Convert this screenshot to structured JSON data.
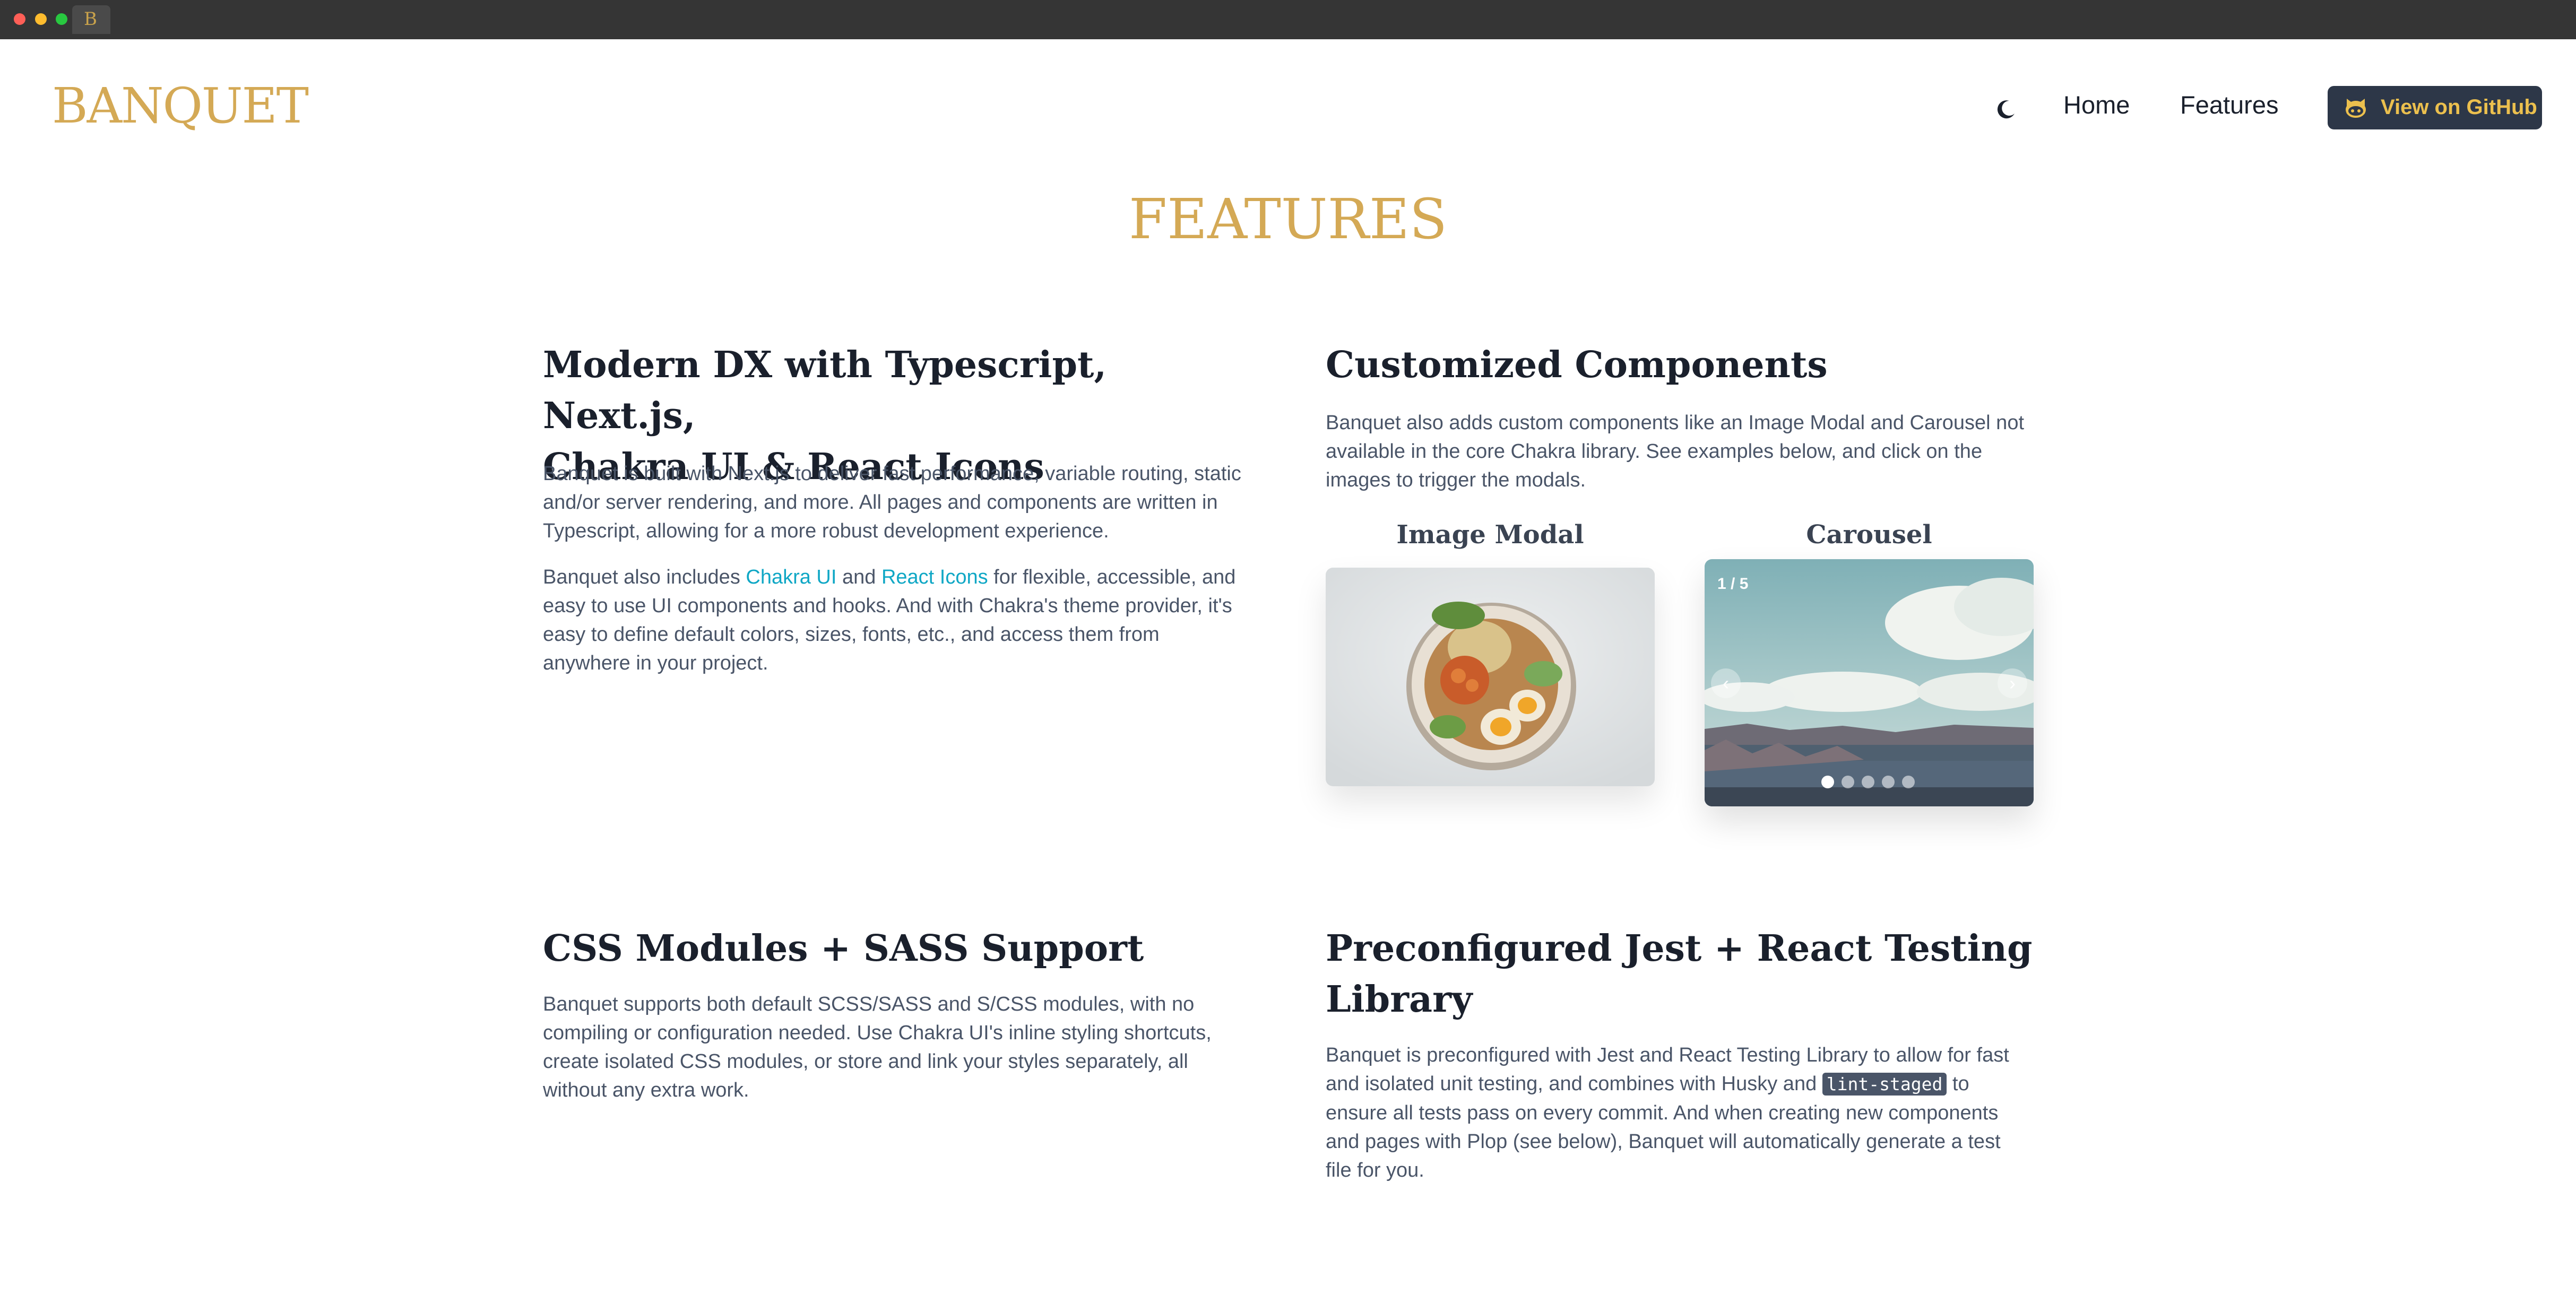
{
  "window": {
    "tab_icon_letter": "B"
  },
  "header": {
    "logo": "BANQUET",
    "theme_toggle_icon": "moon-icon",
    "nav": {
      "home": "Home",
      "features": "Features"
    },
    "github_button": {
      "label": "View on GitHub",
      "icon": "github-octocat-icon"
    }
  },
  "page": {
    "title": "FEATURES"
  },
  "sections": {
    "dx": {
      "heading_line1": "Modern DX with Typescript, Next.js,",
      "heading_line2": "Chakra UI & React Icons",
      "p1": "Banquet is built with Next.js to deliver fast performance, variable routing, static and/or server rendering, and more. All pages and components are written in Typescript, allowing for a more robust development experience.",
      "p2_before": "Banquet also includes ",
      "p2_link1": "Chakra UI",
      "p2_mid": " and ",
      "p2_link2": "React Icons",
      "p2_after": " for flexible, accessible, and easy to use UI components and hooks. And with Chakra's theme provider, it's easy to define default colors, sizes, fonts, etc., and access them from anywhere in your project."
    },
    "components": {
      "heading": "Customized Components",
      "p1": "Banquet also adds custom components like an Image Modal and Carousel not available in the core Chakra library. See examples below, and click on the images to trigger the modals.",
      "image_modal_label": "Image Modal",
      "carousel_label": "Carousel",
      "carousel": {
        "counter": "1 / 5",
        "total_slides": 5,
        "active_slide": 1
      }
    },
    "css": {
      "heading": "CSS Modules + SASS Support",
      "p1": "Banquet supports both default SCSS/SASS and S/CSS modules, with no compiling or configuration needed. Use Chakra UI's inline styling shortcuts, create isolated CSS modules, or store and link your styles separately, all without any extra work."
    },
    "jest": {
      "heading_line1": "Preconfigured Jest + React Testing",
      "heading_line2": "Library",
      "p1_before": "Banquet is preconfigured with Jest and React Testing Library to allow for fast and isolated unit testing, and combines with Husky and ",
      "p1_code": "lint-staged",
      "p1_after": " to ensure all tests pass on every commit. And when creating new components and pages with Plop (see below), Banquet will automatically generate a test file for you."
    }
  },
  "colors": {
    "brand_gold": "#d4a955",
    "link": "#0fa7c5",
    "button_bg": "#2d3748",
    "button_text": "#ecc04e"
  }
}
